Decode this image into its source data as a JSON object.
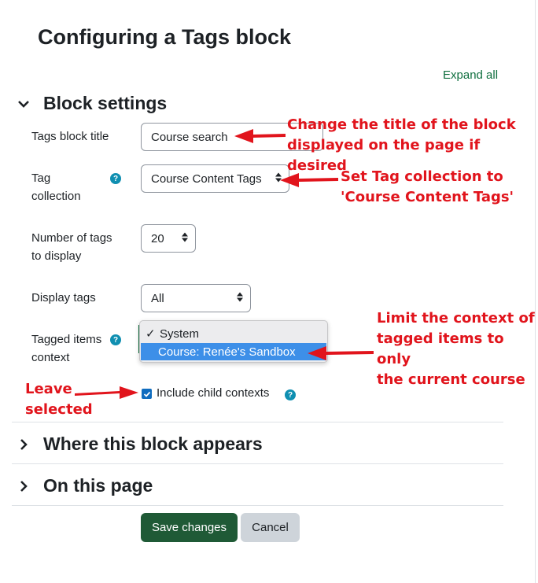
{
  "page": {
    "title": "Configuring a Tags block",
    "expand_all": "Expand all"
  },
  "sections": {
    "block_settings": "Block settings",
    "where_appears": "Where this block appears",
    "on_this_page": "On this page"
  },
  "fields": {
    "title_label": "Tags block title",
    "title_value": "Course search",
    "collection_label_1": "Tag",
    "collection_label_2": "collection",
    "collection_value": "Course Content Tags",
    "num_label_1": "Number of tags",
    "num_label_2": "to display",
    "num_value": "20",
    "display_label": "Display tags",
    "display_value": "All",
    "context_label_1": "Tagged items",
    "context_label_2": "context",
    "context_options": [
      "System",
      "Course: Renée's Sandbox"
    ],
    "context_selected_index": 1,
    "include_child": "Include child contexts",
    "include_child_checked": true
  },
  "buttons": {
    "save": "Save changes",
    "cancel": "Cancel"
  },
  "annotations": {
    "title_1": "Change the title of the block",
    "title_2": "displayed on the page if desired",
    "collection_1": "Set Tag collection to",
    "collection_2": "'Course Content Tags'",
    "context_1": "Limit the context of",
    "context_2": "tagged items to only",
    "context_3": "the current course",
    "leave_1": "Leave",
    "leave_2": "selected"
  },
  "colors": {
    "annotation": "#e1141c",
    "link": "#0f6e3e",
    "primary_button": "#1f5a36",
    "help_icon": "#0f8fb1",
    "dropdown_highlight": "#3d8fe8"
  }
}
